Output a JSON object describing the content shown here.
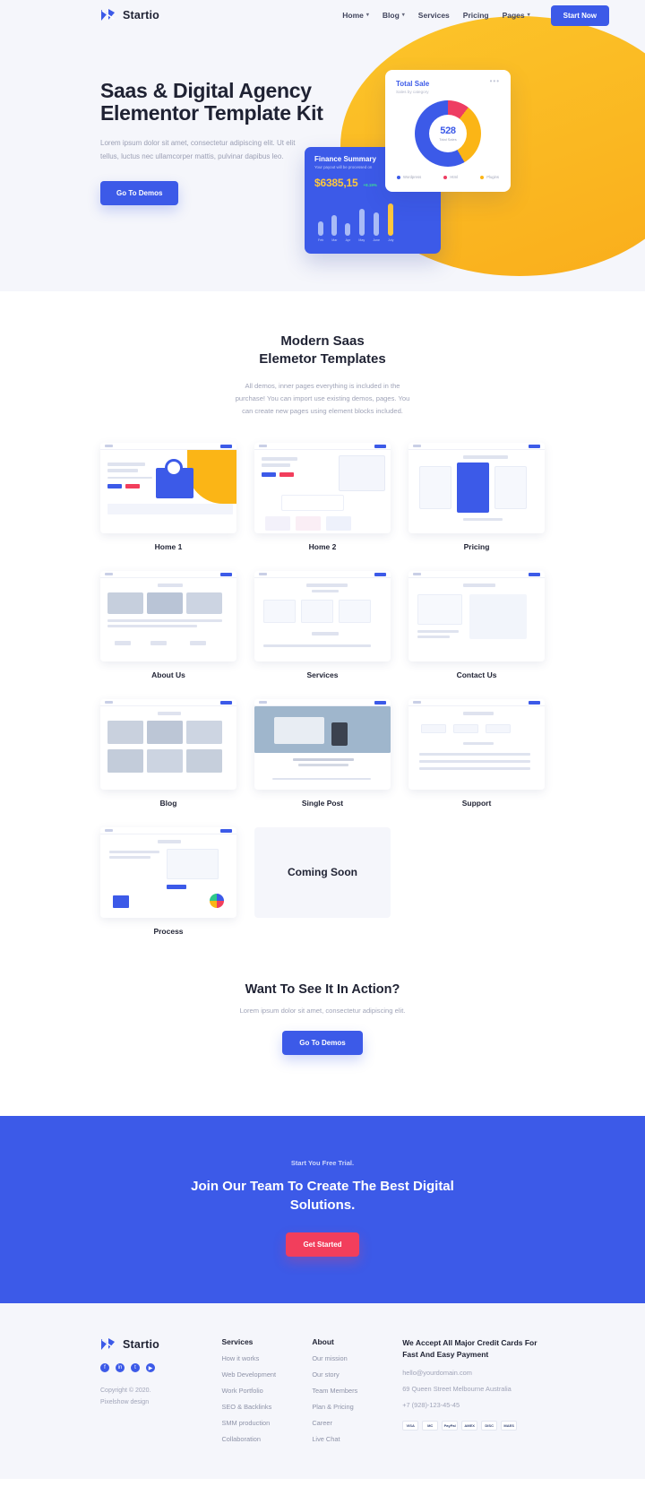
{
  "brand": {
    "name": "Startio",
    "logo_icon": "startio-logo-icon"
  },
  "nav": {
    "links": [
      {
        "label": "Home",
        "has_caret": true
      },
      {
        "label": "Blog",
        "has_caret": true
      },
      {
        "label": "Services",
        "has_caret": false
      },
      {
        "label": "Pricing",
        "has_caret": false
      },
      {
        "label": "Pages",
        "has_caret": true
      }
    ],
    "cta": "Start Now"
  },
  "hero": {
    "title": "Saas & Digital Agency Elementor Template Kit",
    "subtitle": "Lorem ipsum dolor sit amet, consectetur adipiscing elit. Ut elit tellus, luctus nec ullamcorper mattis, pulvinar dapibus leo.",
    "cta": "Go To Demos"
  },
  "finance_card": {
    "title": "Finance Summary",
    "subtitle": "Your payout will be processed on",
    "amount": "$6385,15",
    "delta": "+8.19%"
  },
  "sale_card": {
    "title": "Total Sale",
    "subtitle": "Sales by category",
    "menu_icon": "ellipsis-icon",
    "center_value": "528",
    "center_caption": "Total Sales"
  },
  "chart_data": [
    {
      "type": "bar",
      "title": "Finance Summary",
      "categories": [
        "Feb",
        "Mar",
        "Apr",
        "May",
        "June",
        "July"
      ],
      "values": [
        28,
        40,
        24,
        52,
        44,
        62
      ],
      "xlabel": "",
      "ylabel": "",
      "ylim": [
        0,
        70
      ],
      "colors": [
        "#a9bbf6",
        "#a9bbf6",
        "#a9bbf6",
        "#a9bbf6",
        "#a9bbf6",
        "#ffc83d"
      ],
      "grid": false,
      "legend": "none"
    },
    {
      "type": "pie",
      "title": "Total Sale",
      "subtitle": "Sales by category",
      "labels": [
        "Wordpress",
        "Html",
        "Plugins"
      ],
      "values": [
        58,
        11,
        31
      ],
      "colors": [
        "#3c5ae8",
        "#ee3d62",
        "#fbb516"
      ],
      "center_label": "528",
      "center_sublabel": "Total Sales",
      "legend": "bottom",
      "donut": true
    }
  ],
  "demos": {
    "title_line1": "Modern Saas",
    "title_line2": "Elemetor Templates",
    "description": "All demos, inner pages everything is included in the purchase! You can import use existing demos, pages. You can create new pages using element blocks included.",
    "items": [
      {
        "caption": "Home 1"
      },
      {
        "caption": "Home 2"
      },
      {
        "caption": "Pricing"
      },
      {
        "caption": "About Us"
      },
      {
        "caption": "Services"
      },
      {
        "caption": "Contact Us"
      },
      {
        "caption": "Blog"
      },
      {
        "caption": "Single Post"
      },
      {
        "caption": "Support"
      },
      {
        "caption": "Process"
      }
    ],
    "coming_soon": "Coming Soon"
  },
  "action": {
    "title": "Want To See It In Action?",
    "subtitle": "Lorem ipsum dolor sit amet, consectetur adipiscing elit.",
    "cta": "Go To Demos"
  },
  "banner": {
    "eyebrow": "Start You Free Trial.",
    "title": "Join Our Team To Create The Best Digital Solutions.",
    "cta": "Get Started",
    "accent": "#f23e5c",
    "background": "#3c5ae8"
  },
  "footer": {
    "brand": "Startio",
    "socials": [
      {
        "name": "facebook-icon",
        "glyph": "f"
      },
      {
        "name": "linkedin-icon",
        "glyph": "in"
      },
      {
        "name": "twitter-icon",
        "glyph": "t"
      },
      {
        "name": "youtube-icon",
        "glyph": "▶"
      }
    ],
    "copyright": "Copyright © 2020.\nPixelshow design",
    "services": {
      "heading": "Services",
      "links": [
        "How it works",
        "Web Development",
        "Work Portfolio",
        "SEO & Backlinks",
        "SMM production",
        "Collaboration"
      ]
    },
    "about": {
      "heading": "About",
      "links": [
        "Our mission",
        "Our story",
        "Team Members",
        "Plan & Pricing",
        "Career",
        "Live Chat"
      ]
    },
    "contact": {
      "heading": "We Accept All Major Credit Cards For Fast And Easy Payment",
      "email": "hello@yourdomain.com",
      "address": "69 Queen Street Melbourne Australia",
      "phone": "+7 (928)-123-45-45",
      "cards": [
        "VISA",
        "MC",
        "PayPal",
        "AMEX",
        "DISC",
        "MAES"
      ]
    }
  }
}
